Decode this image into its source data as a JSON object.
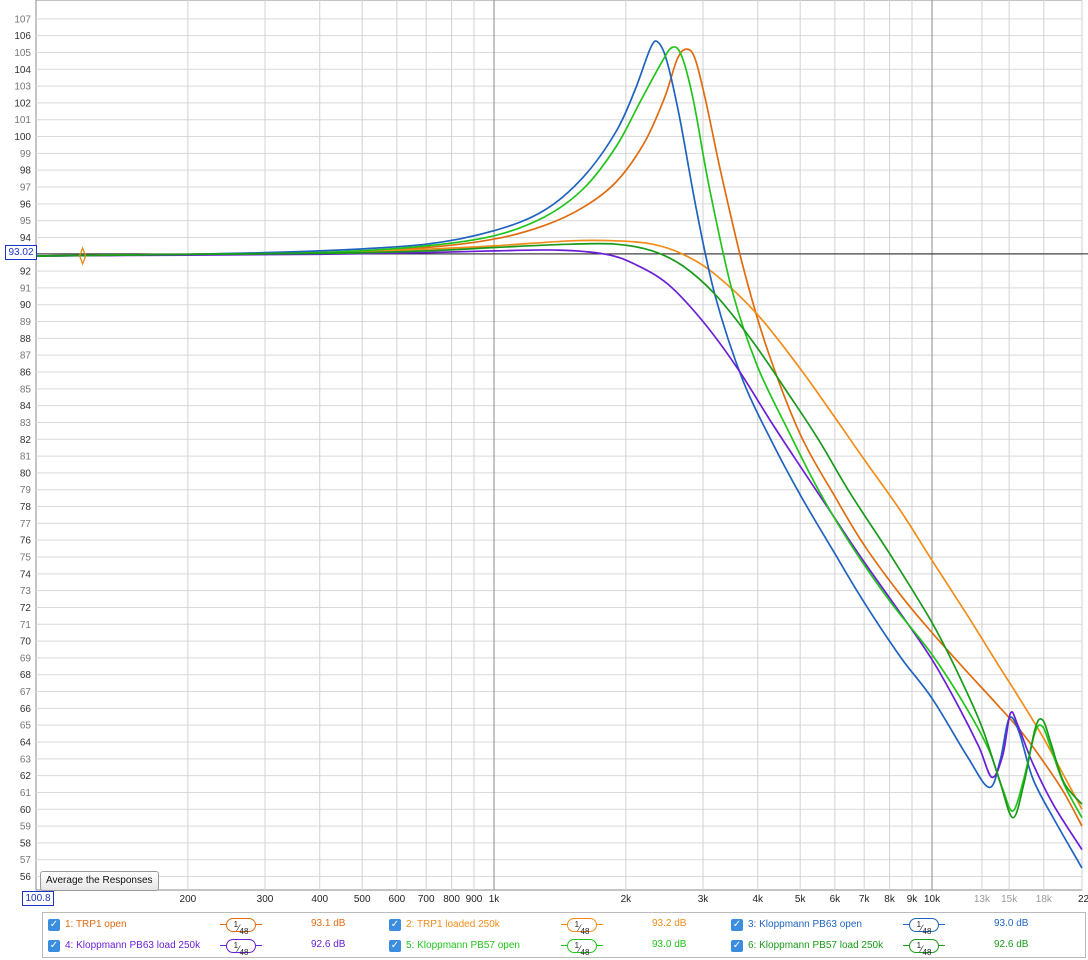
{
  "chart_data": {
    "type": "line",
    "x_scale": "log",
    "xlim": [
      90,
      22000
    ],
    "ylim": [
      55.2,
      108
    ],
    "x_ticks": [
      {
        "v": 200,
        "label": "200"
      },
      {
        "v": 300,
        "label": "300"
      },
      {
        "v": 400,
        "label": "400"
      },
      {
        "v": 500,
        "label": "500"
      },
      {
        "v": 600,
        "label": "600"
      },
      {
        "v": 700,
        "label": "700"
      },
      {
        "v": 800,
        "label": "800"
      },
      {
        "v": 900,
        "label": "900"
      },
      {
        "v": 1000,
        "label": "1k"
      },
      {
        "v": 2000,
        "label": "2k"
      },
      {
        "v": 3000,
        "label": "3k"
      },
      {
        "v": 4000,
        "label": "4k"
      },
      {
        "v": 5000,
        "label": "5k"
      },
      {
        "v": 6000,
        "label": "6k"
      },
      {
        "v": 7000,
        "label": "7k"
      },
      {
        "v": 8000,
        "label": "8k"
      },
      {
        "v": 9000,
        "label": "9k"
      },
      {
        "v": 10000,
        "label": "10k"
      },
      {
        "v": 13000,
        "label": "13k",
        "light": true
      },
      {
        "v": 15000,
        "label": "15k",
        "light": true
      },
      {
        "v": 18000,
        "label": "18k",
        "light": true
      },
      {
        "v": 22000,
        "label": "22kHz"
      }
    ],
    "y_ticks": [
      56,
      57,
      58,
      59,
      60,
      61,
      62,
      63,
      64,
      65,
      66,
      67,
      68,
      69,
      70,
      71,
      72,
      73,
      74,
      75,
      76,
      77,
      78,
      79,
      80,
      81,
      82,
      83,
      84,
      85,
      86,
      87,
      88,
      89,
      90,
      91,
      92,
      93,
      94,
      95,
      96,
      97,
      98,
      99,
      100,
      101,
      102,
      103,
      104,
      105,
      106,
      107
    ],
    "cursor_level": 93.02,
    "cursor_level_label": "93.02",
    "origin_label": "100.8",
    "series": [
      {
        "name": "1: TRP1 open",
        "color": "#e06c10",
        "smoothing": "1/48",
        "level": "93.1 dB",
        "points": [
          [
            90,
            92.9
          ],
          [
            200,
            93.0
          ],
          [
            400,
            93.1
          ],
          [
            700,
            93.4
          ],
          [
            1000,
            93.9
          ],
          [
            1300,
            94.7
          ],
          [
            1600,
            95.8
          ],
          [
            1900,
            97.3
          ],
          [
            2200,
            99.6
          ],
          [
            2450,
            102.3
          ],
          [
            2620,
            104.6
          ],
          [
            2750,
            105.2
          ],
          [
            2880,
            104.6
          ],
          [
            3050,
            102.0
          ],
          [
            3300,
            97.8
          ],
          [
            3700,
            92.3
          ],
          [
            4200,
            87.4
          ],
          [
            5000,
            82.3
          ],
          [
            6000,
            78.6
          ],
          [
            7000,
            75.7
          ],
          [
            8500,
            72.7
          ],
          [
            10000,
            70.5
          ],
          [
            12000,
            68.2
          ],
          [
            14000,
            66.3
          ],
          [
            16000,
            64.6
          ],
          [
            18000,
            62.8
          ],
          [
            20000,
            61.0
          ],
          [
            22000,
            59.0
          ]
        ]
      },
      {
        "name": "2: TRP1 loaded 250k",
        "color": "#f28c1a",
        "smoothing": "1/48",
        "level": "93.2 dB",
        "points": [
          [
            90,
            92.9
          ],
          [
            200,
            93.0
          ],
          [
            400,
            93.1
          ],
          [
            700,
            93.3
          ],
          [
            1000,
            93.5
          ],
          [
            1500,
            93.8
          ],
          [
            1900,
            93.8
          ],
          [
            2300,
            93.6
          ],
          [
            2700,
            93.0
          ],
          [
            3200,
            91.8
          ],
          [
            4000,
            89.4
          ],
          [
            5000,
            86.2
          ],
          [
            6000,
            83.3
          ],
          [
            7000,
            80.8
          ],
          [
            8500,
            77.7
          ],
          [
            10000,
            74.8
          ],
          [
            12000,
            71.6
          ],
          [
            14000,
            68.8
          ],
          [
            16000,
            66.4
          ],
          [
            18000,
            64.2
          ],
          [
            20000,
            62.0
          ],
          [
            22000,
            60.0
          ]
        ]
      },
      {
        "name": "3: Kloppmann PB63 open",
        "color": "#1f63c0",
        "smoothing": "1/48",
        "level": "93.0 dB",
        "points": [
          [
            90,
            92.9
          ],
          [
            200,
            93.0
          ],
          [
            400,
            93.2
          ],
          [
            700,
            93.6
          ],
          [
            1000,
            94.4
          ],
          [
            1300,
            95.6
          ],
          [
            1600,
            97.6
          ],
          [
            1900,
            100.3
          ],
          [
            2100,
            102.8
          ],
          [
            2280,
            105.3
          ],
          [
            2370,
            105.6
          ],
          [
            2480,
            104.5
          ],
          [
            2650,
            101.2
          ],
          [
            2900,
            95.6
          ],
          [
            3200,
            90.5
          ],
          [
            3700,
            85.5
          ],
          [
            4300,
            81.9
          ],
          [
            5000,
            78.7
          ],
          [
            6000,
            75.2
          ],
          [
            7000,
            72.3
          ],
          [
            8500,
            69.0
          ],
          [
            10000,
            66.6
          ],
          [
            12000,
            63.2
          ],
          [
            13500,
            61.3
          ],
          [
            14300,
            62.9
          ],
          [
            15000,
            65.4
          ],
          [
            15800,
            64.6
          ],
          [
            17000,
            61.8
          ],
          [
            19000,
            59.4
          ],
          [
            22000,
            56.5
          ]
        ]
      },
      {
        "name": "4: Kloppmann PB63 load 250k",
        "color": "#6a1fd6",
        "smoothing": "1/48",
        "level": "92.6 dB",
        "points": [
          [
            90,
            92.9
          ],
          [
            200,
            92.95
          ],
          [
            400,
            93.0
          ],
          [
            700,
            93.1
          ],
          [
            1000,
            93.2
          ],
          [
            1400,
            93.25
          ],
          [
            1800,
            93.0
          ],
          [
            2100,
            92.4
          ],
          [
            2500,
            91.2
          ],
          [
            3000,
            89.0
          ],
          [
            3600,
            86.2
          ],
          [
            4300,
            83.0
          ],
          [
            5000,
            80.4
          ],
          [
            6000,
            77.3
          ],
          [
            7000,
            74.7
          ],
          [
            8500,
            71.6
          ],
          [
            10000,
            68.9
          ],
          [
            11500,
            66.1
          ],
          [
            12800,
            63.7
          ],
          [
            13700,
            61.9
          ],
          [
            14500,
            63.2
          ],
          [
            15100,
            65.7
          ],
          [
            15700,
            65.0
          ],
          [
            17000,
            62.7
          ],
          [
            19000,
            60.2
          ],
          [
            22000,
            57.6
          ]
        ]
      },
      {
        "name": "5: Kloppmann PB57 open",
        "color": "#22c41c",
        "smoothing": "1/48",
        "level": "93.0 dB",
        "points": [
          [
            90,
            92.9
          ],
          [
            200,
            93.0
          ],
          [
            400,
            93.1
          ],
          [
            700,
            93.5
          ],
          [
            1000,
            94.1
          ],
          [
            1300,
            95.2
          ],
          [
            1600,
            96.9
          ],
          [
            1900,
            99.4
          ],
          [
            2150,
            102.0
          ],
          [
            2400,
            104.3
          ],
          [
            2550,
            105.3
          ],
          [
            2680,
            104.8
          ],
          [
            2850,
            102.2
          ],
          [
            3100,
            97.0
          ],
          [
            3500,
            90.8
          ],
          [
            4000,
            86.3
          ],
          [
            4700,
            82.5
          ],
          [
            5500,
            79.0
          ],
          [
            6500,
            75.8
          ],
          [
            8000,
            72.4
          ],
          [
            10000,
            69.2
          ],
          [
            12000,
            66.0
          ],
          [
            13500,
            63.5
          ],
          [
            14500,
            61.2
          ],
          [
            15300,
            59.9
          ],
          [
            16200,
            61.8
          ],
          [
            17200,
            64.6
          ],
          [
            17900,
            64.9
          ],
          [
            18700,
            63.6
          ],
          [
            20000,
            61.5
          ],
          [
            22000,
            59.5
          ]
        ]
      },
      {
        "name": "6: Kloppmann PB57 load 250k",
        "color": "#1a9a1a",
        "smoothing": "1/48",
        "level": "92.6 dB",
        "points": [
          [
            90,
            92.9
          ],
          [
            200,
            93.0
          ],
          [
            400,
            93.05
          ],
          [
            700,
            93.2
          ],
          [
            1000,
            93.4
          ],
          [
            1500,
            93.6
          ],
          [
            1900,
            93.6
          ],
          [
            2300,
            93.2
          ],
          [
            2700,
            92.3
          ],
          [
            3200,
            90.6
          ],
          [
            3900,
            87.8
          ],
          [
            4700,
            84.7
          ],
          [
            5500,
            82.0
          ],
          [
            6500,
            78.8
          ],
          [
            8000,
            75.2
          ],
          [
            10000,
            71.1
          ],
          [
            11500,
            68.0
          ],
          [
            13000,
            64.9
          ],
          [
            14300,
            61.6
          ],
          [
            15300,
            59.5
          ],
          [
            16200,
            61.5
          ],
          [
            17200,
            64.8
          ],
          [
            17900,
            65.3
          ],
          [
            18700,
            63.9
          ],
          [
            20000,
            61.6
          ],
          [
            22000,
            60.3
          ]
        ]
      }
    ]
  },
  "controls": {
    "average_button": "Average the Responses"
  },
  "legend": {
    "smoothing_numerator": "1",
    "smoothing_denominator": "48"
  }
}
